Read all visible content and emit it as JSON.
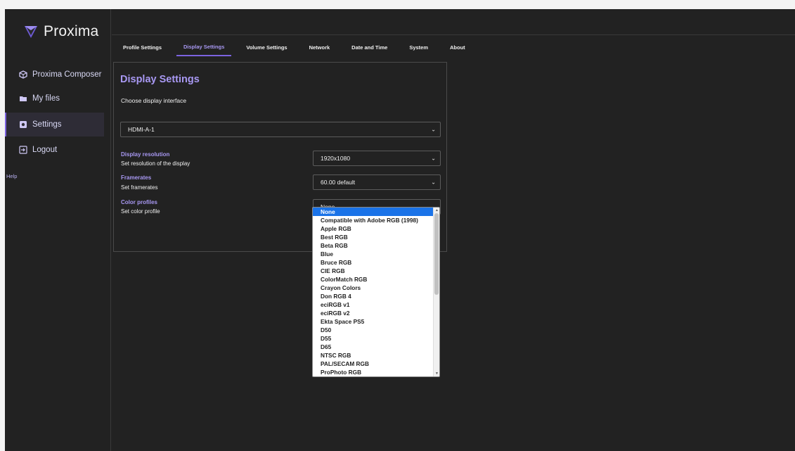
{
  "app": {
    "name": "Proxima"
  },
  "sidebar": {
    "items": [
      {
        "label": "Proxima Composer",
        "icon": "cube-icon"
      },
      {
        "label": "My files",
        "icon": "folder-icon"
      },
      {
        "label": "Settings",
        "icon": "settings-icon"
      },
      {
        "label": "Logout",
        "icon": "logout-icon"
      }
    ],
    "help": "Help"
  },
  "tabs": [
    {
      "label": "Profile Settings"
    },
    {
      "label": "Display Settings"
    },
    {
      "label": "Volume Settings"
    },
    {
      "label": "Network"
    },
    {
      "label": "Date and Time"
    },
    {
      "label": "System"
    },
    {
      "label": "About"
    }
  ],
  "panel": {
    "title": "Display Settings",
    "interface_label": "Choose display interface",
    "interface_value": "HDMI-A-1",
    "resolution": {
      "label": "Display resolution",
      "sub": "Set resolution of the display",
      "value": "1920x1080"
    },
    "framerates": {
      "label": "Framerates",
      "sub": "Set framerates",
      "value": "60.00 default"
    },
    "color": {
      "label": "Color profiles",
      "sub": "Set color profile",
      "value": "None"
    }
  },
  "dropdown": {
    "options": [
      "None",
      "Compatible with Adobe RGB (1998)",
      "Apple RGB",
      "Best RGB",
      "Beta RGB",
      "Blue",
      "Bruce RGB",
      "CIE RGB",
      "ColorMatch RGB",
      "Crayon Colors",
      "Don RGB 4",
      "eciRGB v1",
      "eciRGB v2",
      "Ekta Space PS5",
      "D50",
      "D55",
      "D65",
      "NTSC RGB",
      "PAL/SECAM RGB",
      "ProPhoto RGB"
    ],
    "selected": "None"
  },
  "colors": {
    "accent": "#7c63e0",
    "accent_text": "#a898f2",
    "background": "#222222",
    "selected_option": "#1a73e8"
  }
}
